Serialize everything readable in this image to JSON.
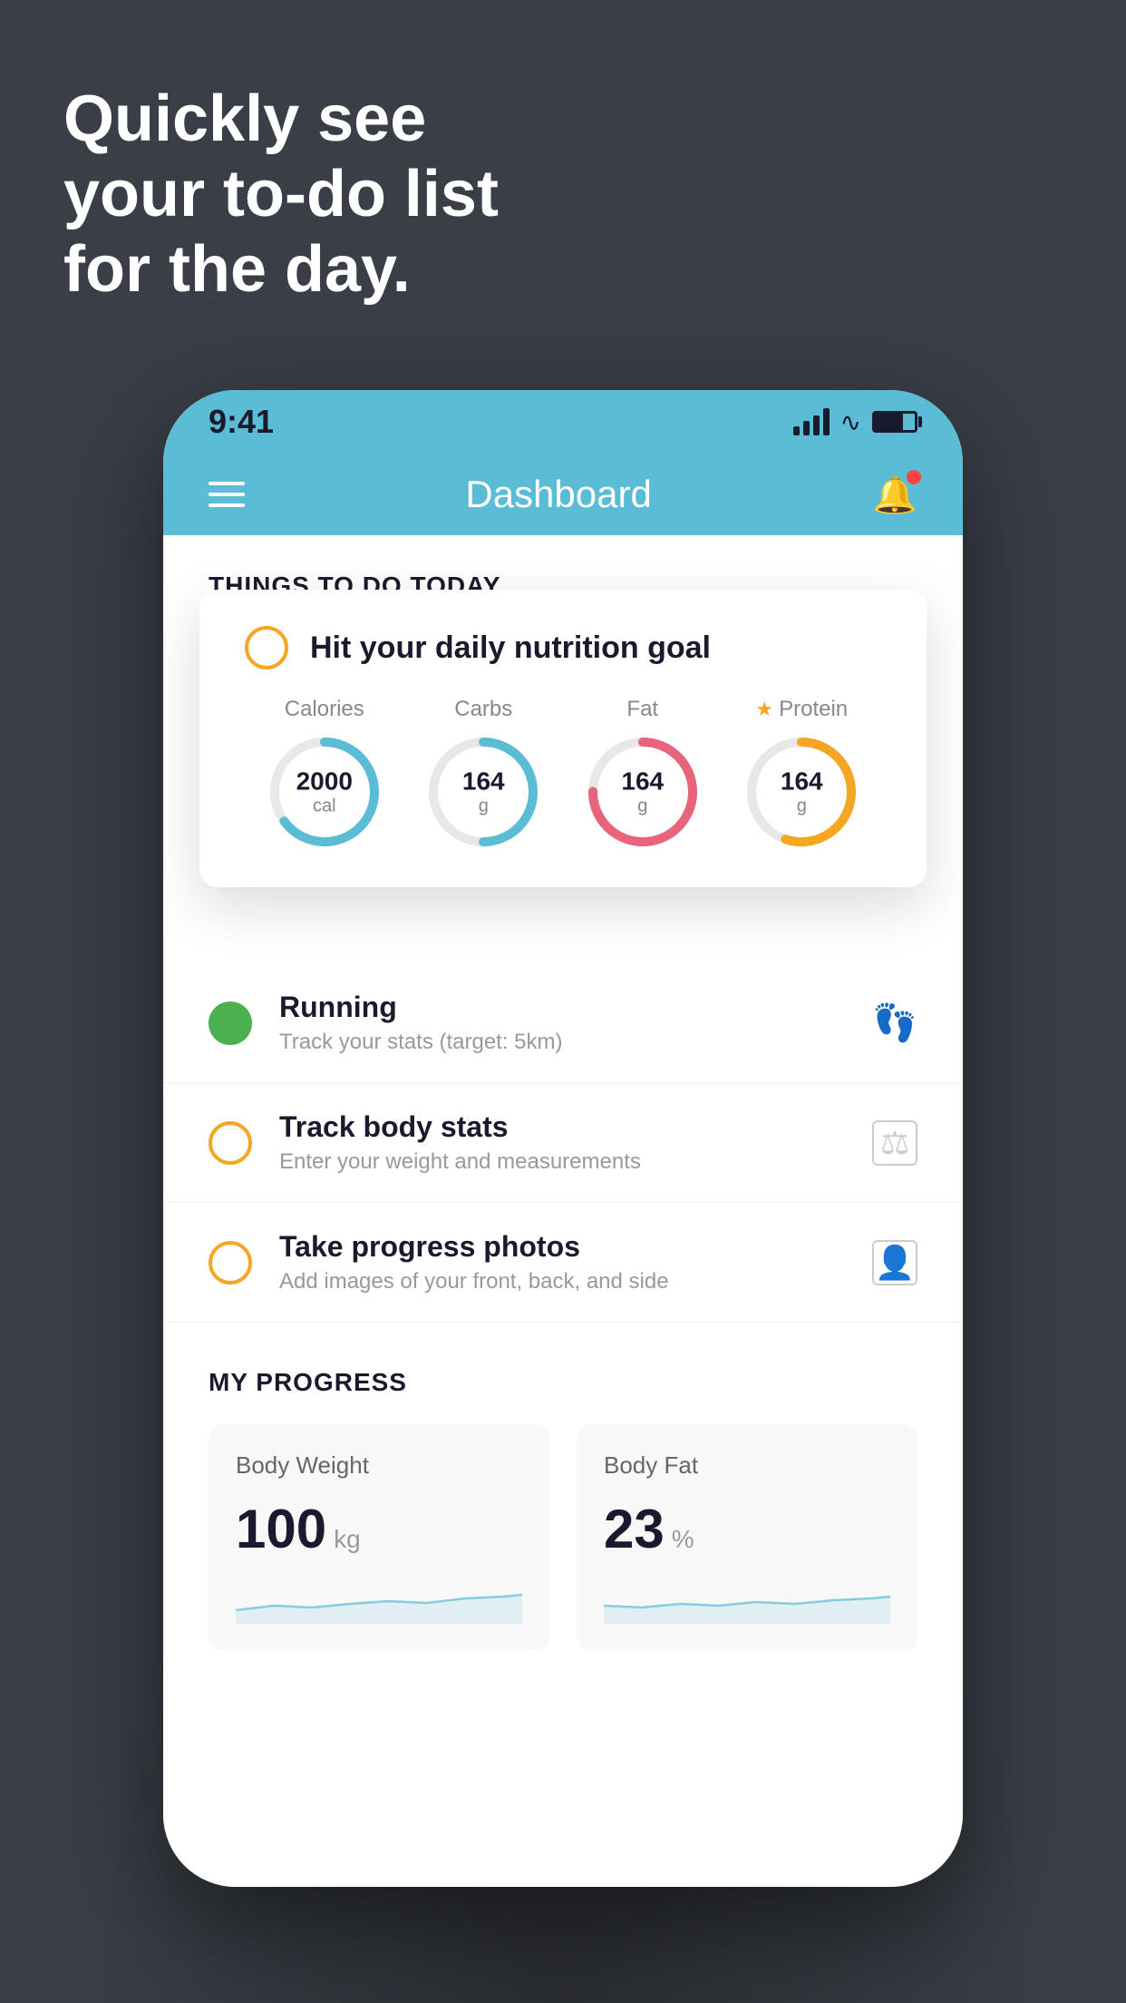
{
  "hero": {
    "text_line1": "Quickly see",
    "text_line2": "your to-do list",
    "text_line3": "for the day."
  },
  "phone": {
    "status_bar": {
      "time": "9:41"
    },
    "nav": {
      "title": "Dashboard"
    },
    "section_title": "THINGS TO DO TODAY",
    "featured_card": {
      "title": "Hit your daily nutrition goal",
      "checkbox_state": "incomplete",
      "nutrition": [
        {
          "label": "Calories",
          "value": "2000",
          "unit": "cal",
          "color": "#5bbcd6",
          "progress": 0.65,
          "has_star": false
        },
        {
          "label": "Carbs",
          "value": "164",
          "unit": "g",
          "color": "#5bbcd6",
          "progress": 0.5,
          "has_star": false
        },
        {
          "label": "Fat",
          "value": "164",
          "unit": "g",
          "color": "#e8647a",
          "progress": 0.75,
          "has_star": false
        },
        {
          "label": "Protein",
          "value": "164",
          "unit": "g",
          "color": "#f5a623",
          "progress": 0.55,
          "has_star": true
        }
      ]
    },
    "todo_items": [
      {
        "id": "running",
        "title": "Running",
        "subtitle": "Track your stats (target: 5km)",
        "checkbox_color": "green",
        "icon": "🏃"
      },
      {
        "id": "body-stats",
        "title": "Track body stats",
        "subtitle": "Enter your weight and measurements",
        "checkbox_color": "yellow",
        "icon": "⚖"
      },
      {
        "id": "progress-photos",
        "title": "Take progress photos",
        "subtitle": "Add images of your front, back, and side",
        "checkbox_color": "yellow",
        "icon": "👤"
      }
    ],
    "my_progress": {
      "section_title": "MY PROGRESS",
      "cards": [
        {
          "title": "Body Weight",
          "value": "100",
          "unit": "kg"
        },
        {
          "title": "Body Fat",
          "value": "23",
          "unit": "%"
        }
      ]
    }
  }
}
